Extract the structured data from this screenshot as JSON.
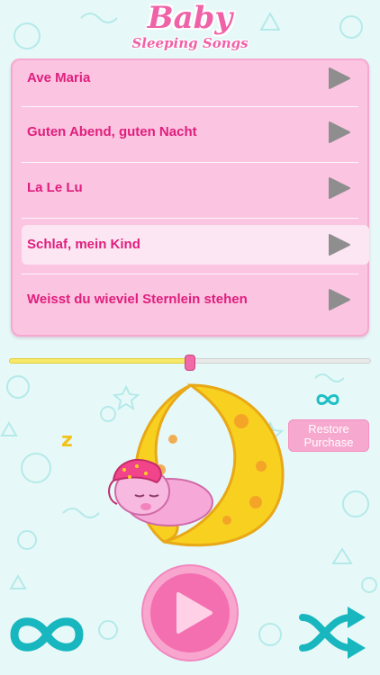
{
  "header": {
    "title": "Baby",
    "subtitle": "Sleeping Songs"
  },
  "songs": [
    {
      "label": "Ave Maria",
      "selected": false
    },
    {
      "label": "Guten Abend, guten Nacht",
      "selected": false
    },
    {
      "label": "La Le Lu",
      "selected": false
    },
    {
      "label": "Schlaf, mein Kind",
      "selected": true
    },
    {
      "label": "Weisst du wieviel Sternlein stehen",
      "selected": false
    }
  ],
  "progress": {
    "value": 0.5
  },
  "restore": {
    "line1": "Restore",
    "line2": "Purchase"
  },
  "icons": {
    "small_loop": "infinity-icon",
    "loop": "infinity-icon",
    "play": "play-icon",
    "shuffle": "shuffle-icon",
    "sleep": "sleeping-baby-on-moon"
  },
  "colors": {
    "brand_pink": "#f062a8",
    "song_text": "#e01e7d",
    "panel": "#fbc4e1",
    "accent_teal": "#1fbfc6",
    "moon_yellow": "#f7d020"
  }
}
